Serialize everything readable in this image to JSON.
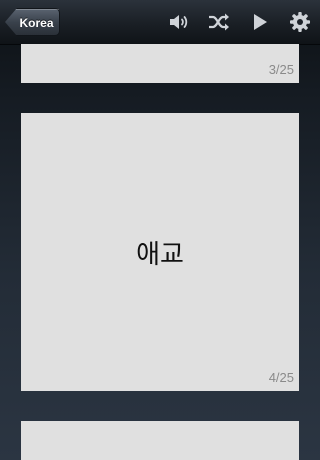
{
  "navbar": {
    "back_label": "Korea",
    "icons": [
      "speaker-icon",
      "shuffle-icon",
      "play-icon",
      "gear-icon"
    ]
  },
  "cards": [
    {
      "counter": "3/25",
      "word": ""
    },
    {
      "counter": "4/25",
      "word": "애교"
    },
    {
      "counter": "",
      "word": ""
    }
  ]
}
